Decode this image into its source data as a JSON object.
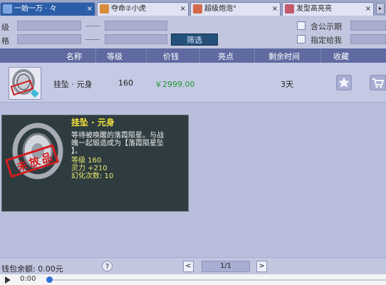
{
  "tabs": [
    {
      "label": "一始一万 · 々",
      "close": "×",
      "active": true,
      "icon_color": "#7da6e0"
    },
    {
      "label": "夺命②小虎",
      "close": "×",
      "active": false,
      "icon_color": "#d98b3a"
    },
    {
      "label": "超级炮泡°",
      "close": "×",
      "active": false,
      "icon_color": "#d46a4a"
    },
    {
      "label": "发型高亮亮",
      "close": "×",
      "active": false,
      "icon_color": "#c25a6a"
    }
  ],
  "filter": {
    "level_label": "级",
    "price_label": "格",
    "dash": "—",
    "filter_button": "筛选",
    "public_option": "含公示期",
    "designated_option": "指定给我"
  },
  "table": {
    "columns": [
      "名称",
      "等级",
      "价钱",
      "亮点",
      "剩余时间",
      "收藏"
    ],
    "rows": [
      {
        "name": "挂坠 · 元身",
        "level": "160",
        "price": "￥2999.00",
        "highlight": "",
        "remaining": "3天"
      }
    ]
  },
  "tooltip": {
    "title": "挂坠 · 元身",
    "desc_line1": "等待被唤醒的落霞陨星。与战",
    "desc_line2": "魄一起锻造成为【落霞陨星坠",
    "desc_line3": "】。",
    "stat_level": "等级 160",
    "stat_spirit": "灵力 +210",
    "stat_transform": "幻化次数: 10",
    "stamp_text": "未放品"
  },
  "footer": {
    "balance": "钱包余额: 0.00元",
    "help": "?",
    "prev": "<",
    "page": "1/1",
    "next": ">"
  },
  "player": {
    "time": "0:00"
  },
  "colors": {
    "accent": "#5e6aa0",
    "price_green": "#1f9a3a",
    "tooltip_title": "#f3e33a",
    "tooltip_stat": "#e8e86a"
  }
}
